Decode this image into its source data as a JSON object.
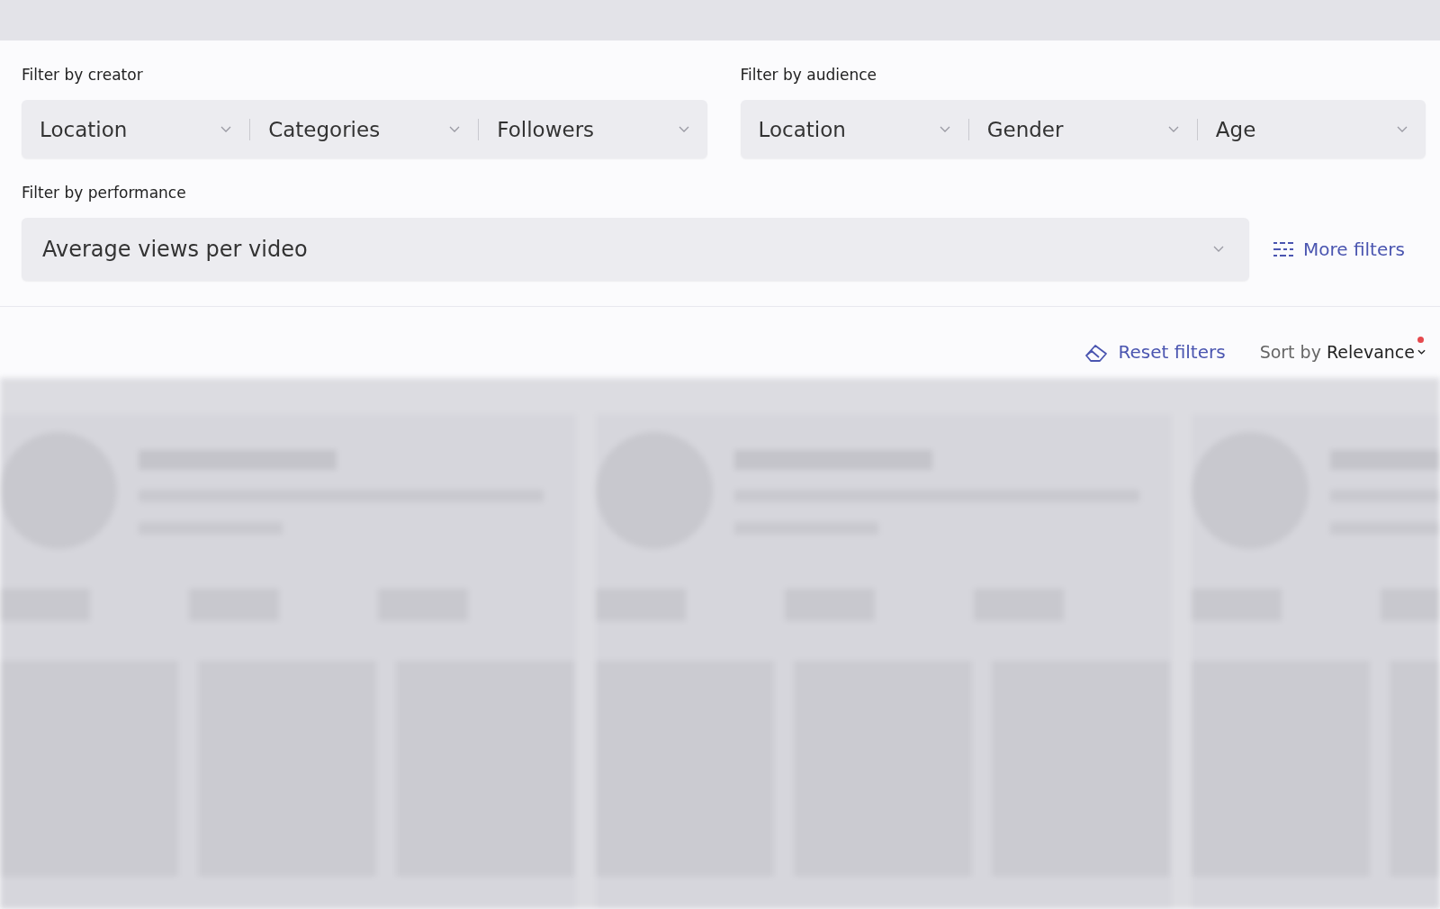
{
  "filter_groups": [
    {
      "label": "Filter by creator",
      "dropdowns": [
        "Location",
        "Categories",
        "Followers"
      ]
    },
    {
      "label": "Filter by audience",
      "dropdowns": [
        "Location",
        "Gender",
        "Age"
      ]
    }
  ],
  "performance": {
    "label": "Filter by performance",
    "dropdown": "Average views per video",
    "more_filters": "More filters"
  },
  "toolbar": {
    "reset": "Reset filters",
    "sort_prefix": "Sort by",
    "sort_value": "Relevance",
    "sort_indicator": true
  }
}
